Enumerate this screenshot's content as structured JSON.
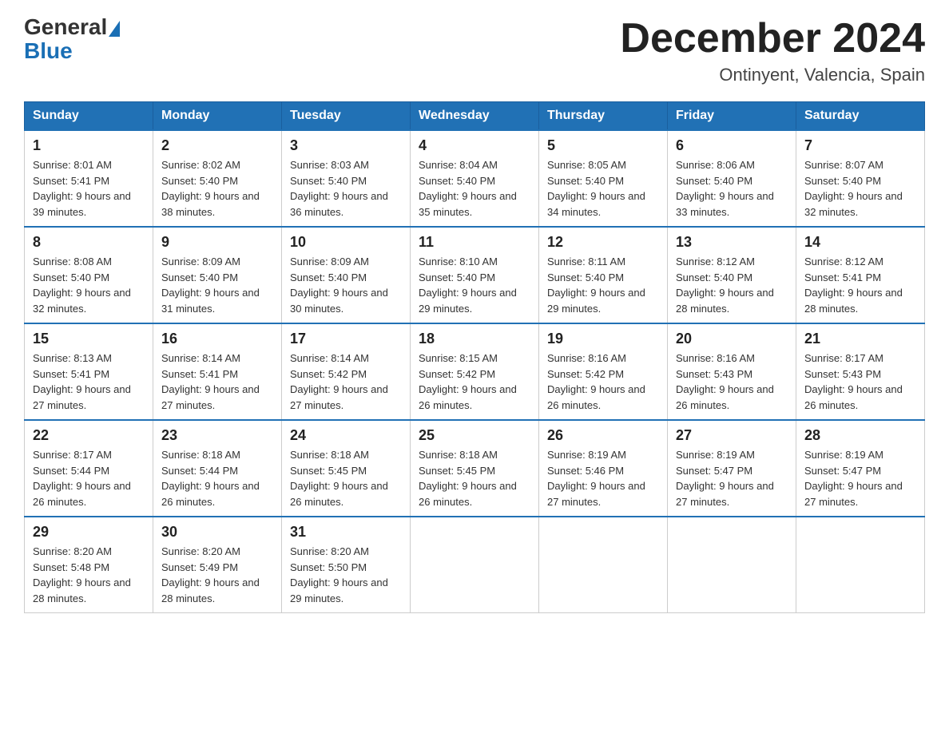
{
  "header": {
    "logo_general": "General",
    "logo_blue": "Blue",
    "month_title": "December 2024",
    "location": "Ontinyent, Valencia, Spain"
  },
  "columns": [
    "Sunday",
    "Monday",
    "Tuesday",
    "Wednesday",
    "Thursday",
    "Friday",
    "Saturday"
  ],
  "weeks": [
    [
      {
        "day": "1",
        "sunrise": "8:01 AM",
        "sunset": "5:41 PM",
        "daylight": "9 hours and 39 minutes."
      },
      {
        "day": "2",
        "sunrise": "8:02 AM",
        "sunset": "5:40 PM",
        "daylight": "9 hours and 38 minutes."
      },
      {
        "day": "3",
        "sunrise": "8:03 AM",
        "sunset": "5:40 PM",
        "daylight": "9 hours and 36 minutes."
      },
      {
        "day": "4",
        "sunrise": "8:04 AM",
        "sunset": "5:40 PM",
        "daylight": "9 hours and 35 minutes."
      },
      {
        "day": "5",
        "sunrise": "8:05 AM",
        "sunset": "5:40 PM",
        "daylight": "9 hours and 34 minutes."
      },
      {
        "day": "6",
        "sunrise": "8:06 AM",
        "sunset": "5:40 PM",
        "daylight": "9 hours and 33 minutes."
      },
      {
        "day": "7",
        "sunrise": "8:07 AM",
        "sunset": "5:40 PM",
        "daylight": "9 hours and 32 minutes."
      }
    ],
    [
      {
        "day": "8",
        "sunrise": "8:08 AM",
        "sunset": "5:40 PM",
        "daylight": "9 hours and 32 minutes."
      },
      {
        "day": "9",
        "sunrise": "8:09 AM",
        "sunset": "5:40 PM",
        "daylight": "9 hours and 31 minutes."
      },
      {
        "day": "10",
        "sunrise": "8:09 AM",
        "sunset": "5:40 PM",
        "daylight": "9 hours and 30 minutes."
      },
      {
        "day": "11",
        "sunrise": "8:10 AM",
        "sunset": "5:40 PM",
        "daylight": "9 hours and 29 minutes."
      },
      {
        "day": "12",
        "sunrise": "8:11 AM",
        "sunset": "5:40 PM",
        "daylight": "9 hours and 29 minutes."
      },
      {
        "day": "13",
        "sunrise": "8:12 AM",
        "sunset": "5:40 PM",
        "daylight": "9 hours and 28 minutes."
      },
      {
        "day": "14",
        "sunrise": "8:12 AM",
        "sunset": "5:41 PM",
        "daylight": "9 hours and 28 minutes."
      }
    ],
    [
      {
        "day": "15",
        "sunrise": "8:13 AM",
        "sunset": "5:41 PM",
        "daylight": "9 hours and 27 minutes."
      },
      {
        "day": "16",
        "sunrise": "8:14 AM",
        "sunset": "5:41 PM",
        "daylight": "9 hours and 27 minutes."
      },
      {
        "day": "17",
        "sunrise": "8:14 AM",
        "sunset": "5:42 PM",
        "daylight": "9 hours and 27 minutes."
      },
      {
        "day": "18",
        "sunrise": "8:15 AM",
        "sunset": "5:42 PM",
        "daylight": "9 hours and 26 minutes."
      },
      {
        "day": "19",
        "sunrise": "8:16 AM",
        "sunset": "5:42 PM",
        "daylight": "9 hours and 26 minutes."
      },
      {
        "day": "20",
        "sunrise": "8:16 AM",
        "sunset": "5:43 PM",
        "daylight": "9 hours and 26 minutes."
      },
      {
        "day": "21",
        "sunrise": "8:17 AM",
        "sunset": "5:43 PM",
        "daylight": "9 hours and 26 minutes."
      }
    ],
    [
      {
        "day": "22",
        "sunrise": "8:17 AM",
        "sunset": "5:44 PM",
        "daylight": "9 hours and 26 minutes."
      },
      {
        "day": "23",
        "sunrise": "8:18 AM",
        "sunset": "5:44 PM",
        "daylight": "9 hours and 26 minutes."
      },
      {
        "day": "24",
        "sunrise": "8:18 AM",
        "sunset": "5:45 PM",
        "daylight": "9 hours and 26 minutes."
      },
      {
        "day": "25",
        "sunrise": "8:18 AM",
        "sunset": "5:45 PM",
        "daylight": "9 hours and 26 minutes."
      },
      {
        "day": "26",
        "sunrise": "8:19 AM",
        "sunset": "5:46 PM",
        "daylight": "9 hours and 27 minutes."
      },
      {
        "day": "27",
        "sunrise": "8:19 AM",
        "sunset": "5:47 PM",
        "daylight": "9 hours and 27 minutes."
      },
      {
        "day": "28",
        "sunrise": "8:19 AM",
        "sunset": "5:47 PM",
        "daylight": "9 hours and 27 minutes."
      }
    ],
    [
      {
        "day": "29",
        "sunrise": "8:20 AM",
        "sunset": "5:48 PM",
        "daylight": "9 hours and 28 minutes."
      },
      {
        "day": "30",
        "sunrise": "8:20 AM",
        "sunset": "5:49 PM",
        "daylight": "9 hours and 28 minutes."
      },
      {
        "day": "31",
        "sunrise": "8:20 AM",
        "sunset": "5:50 PM",
        "daylight": "9 hours and 29 minutes."
      },
      null,
      null,
      null,
      null
    ]
  ]
}
